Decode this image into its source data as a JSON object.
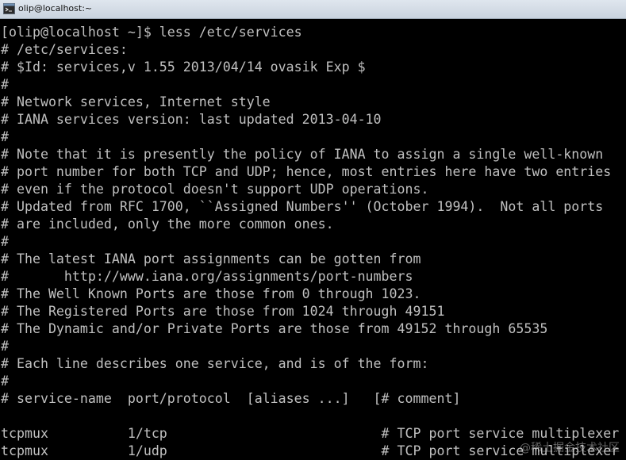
{
  "window": {
    "title": "olip@localhost:~",
    "icon": "terminal-icon"
  },
  "terminal": {
    "lines": [
      "[olip@localhost ~]$ less /etc/services",
      "# /etc/services:",
      "# $Id: services,v 1.55 2013/04/14 ovasik Exp $",
      "#",
      "# Network services, Internet style",
      "# IANA services version: last updated 2013-04-10",
      "#",
      "# Note that it is presently the policy of IANA to assign a single well-known",
      "# port number for both TCP and UDP; hence, most entries here have two entries",
      "# even if the protocol doesn't support UDP operations.",
      "# Updated from RFC 1700, ``Assigned Numbers'' (October 1994).  Not all ports",
      "# are included, only the more common ones.",
      "#",
      "# The latest IANA port assignments can be gotten from",
      "#       http://www.iana.org/assignments/port-numbers",
      "# The Well Known Ports are those from 0 through 1023.",
      "# The Registered Ports are those from 1024 through 49151",
      "# The Dynamic and/or Private Ports are those from 49152 through 65535",
      "#",
      "# Each line describes one service, and is of the form:",
      "#",
      "# service-name  port/protocol  [aliases ...]   [# comment]",
      "",
      "tcpmux          1/tcp                           # TCP port service multiplexer",
      "tcpmux          1/udp                           # TCP port service multiplexer"
    ],
    "text_color": "#c0c0c0",
    "background": "#000000"
  },
  "watermark": {
    "text": "@稀土掘金技术社区"
  }
}
